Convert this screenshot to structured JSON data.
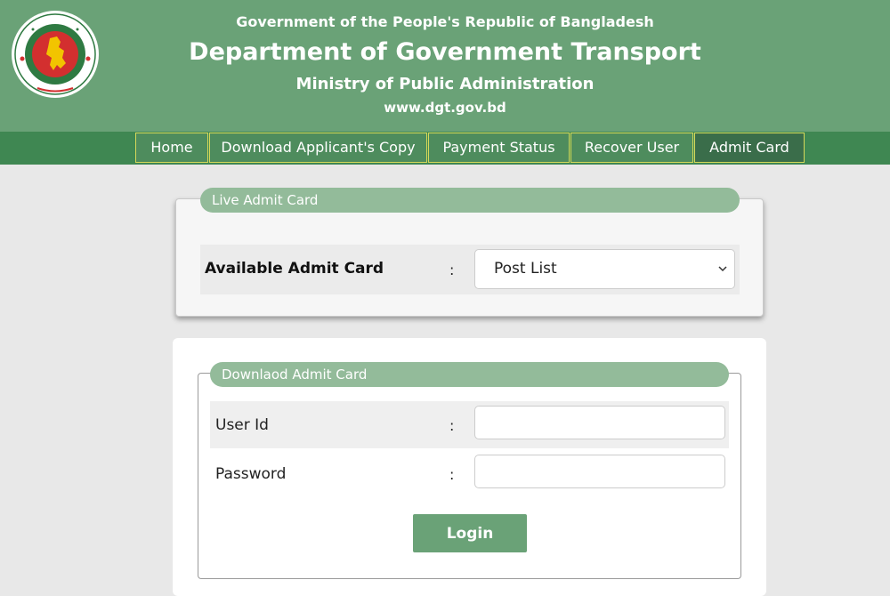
{
  "header": {
    "government": "Government of the People's Republic of Bangladesh",
    "department": "Department of Government Transport",
    "ministry": "Ministry of Public Administration",
    "website": "www.dgt.gov.bd",
    "logo_icon": "bangladesh-government-seal-icon",
    "background_color": "#6aa277"
  },
  "nav": {
    "items": [
      {
        "label": "Home"
      },
      {
        "label": "Download Applicant's Copy"
      },
      {
        "label": "Payment Status"
      },
      {
        "label": "Recover User"
      },
      {
        "label": "Admit Card",
        "active": true
      }
    ],
    "border_color": "#d6d85a"
  },
  "live_admit_card": {
    "legend": "Live Admit Card",
    "label": "Available Admit Card",
    "colon": ":",
    "select_value": "Post List",
    "select_icon": "chevron-down-icon"
  },
  "download_admit_card": {
    "legend": "Downlaod Admit Card",
    "user_id_label": "User Id",
    "password_label": "Password",
    "colon": ":",
    "user_id_value": "",
    "password_value": "",
    "login_label": "Login"
  },
  "colors": {
    "accent": "#6aa277",
    "legend_pill": "#93bb9a",
    "nav_bar": "#3f8752"
  }
}
